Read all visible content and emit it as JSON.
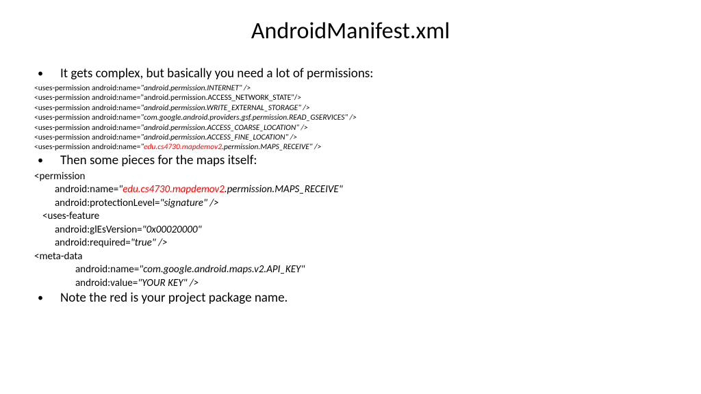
{
  "title": "AndroidManifest.xml",
  "bullet1": "It gets complex, but basically you need a lot of permissions:",
  "perm1_a": "<uses-permission android:name=",
  "perm1_b": "\"android.permission.INTERNET\" />",
  "perm2": " <uses-permission android:name=\"android.permission.ACCESS_NETWORK_STATE\"/>",
  "perm3_a": "<uses-permission android:name=",
  "perm3_b": "\"android.permission.WRITE_EXTERNAL_STORAGE\" />",
  "perm4_a": "<uses-permission android:name=",
  "perm4_b": "\"com.google.android.providers.gsf.permission.READ_GSERVICES\" />",
  "perm5_a": "<uses-permission android:name=",
  "perm5_b": "\"android.permission.ACCESS_COARSE_LOCATION\" />",
  "perm6_a": "<uses-permission android:name=",
  "perm6_b": "\"android.permission.ACCESS_FINE_LOCATION\" />",
  "perm7_a": "<uses-permission android:name=",
  "perm7_b": "\"",
  "perm7_red": "edu.cs4730.mapdemov2",
  "perm7_c": ".permission.MAPS_RECEIVE\" />",
  "bullet2": "Then some pieces for the maps itself:",
  "maps1": "<permission",
  "maps2_a": "android:name=",
  "maps2_b": "\"",
  "maps2_red": "edu.cs4730.mapdemov2",
  "maps2_c": ".permission.MAPS_RECEIVE\"",
  "maps3_a": "android:protectionLevel=",
  "maps3_b": "\"signature\" />",
  "maps4": "<uses-feature",
  "maps5_a": "android:glEsVersion=",
  "maps5_b": "\"0x00020000\"",
  "maps6_a": "android:required=",
  "maps6_b": "\"true\" />",
  "maps7": "<meta-data",
  "maps8_a": "android:name=",
  "maps8_b": "\"com.google.android.maps.v2.API_KEY\"",
  "maps9_a": "android:value=",
  "maps9_b": "\"YOUR KEY\" />",
  "bullet3": "Note the red is your project package name."
}
